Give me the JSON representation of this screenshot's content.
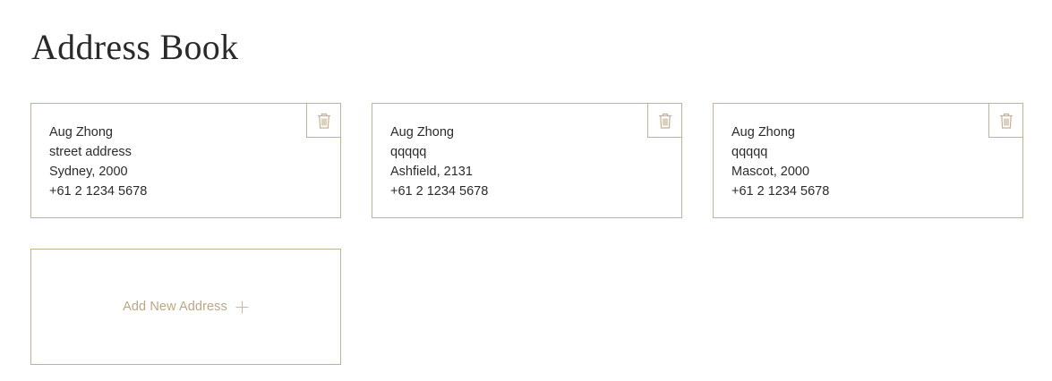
{
  "page": {
    "title": "Address Book"
  },
  "colors": {
    "accent": "#c2b192",
    "accent_text": "#b9a784",
    "text": "#2b2b2b"
  },
  "addresses": [
    {
      "name": "Aug Zhong",
      "street": "street address",
      "city_line": "Sydney, 2000",
      "phone": "+61 2 1234 5678",
      "delete_icon": "trash-icon"
    },
    {
      "name": "Aug Zhong",
      "street": "qqqqq",
      "city_line": "Ashfield, 2131",
      "phone": "+61 2 1234 5678",
      "delete_icon": "trash-icon"
    },
    {
      "name": "Aug Zhong",
      "street": "qqqqq",
      "city_line": "Mascot, 2000",
      "phone": "+61 2 1234 5678",
      "delete_icon": "trash-icon"
    }
  ],
  "add_new": {
    "label": "Add New Address",
    "icon": "plus-icon"
  }
}
